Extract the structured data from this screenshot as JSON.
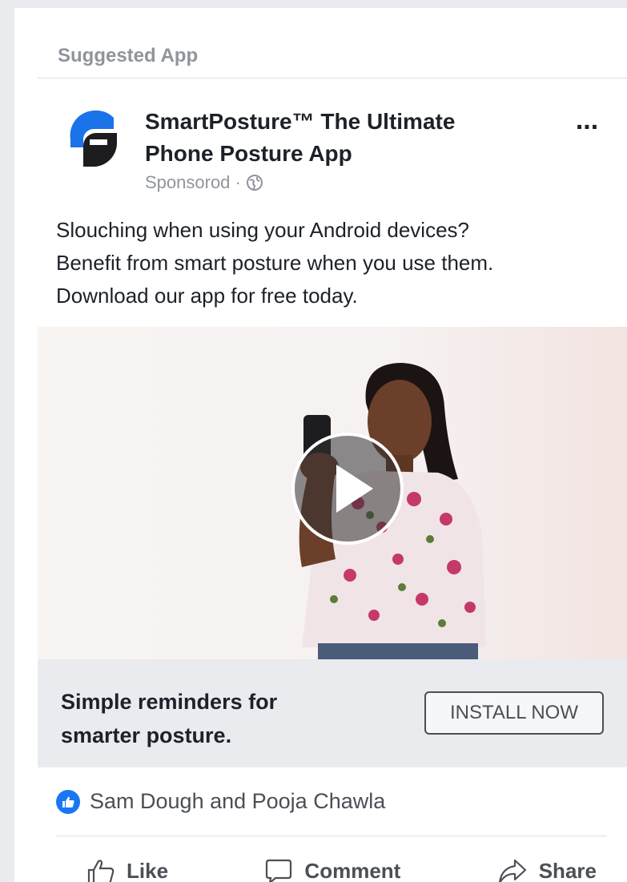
{
  "feed": {
    "header_label": "Suggested App"
  },
  "ad": {
    "title": "SmartPosture™ The Ultimate Phone Posture App",
    "more_label": "...",
    "sponsored_label": "Sponsorod ·",
    "body_lines": [
      "Slouching when using your Android devices?",
      "Benefit from smart posture when you use them.",
      "Download our app for free today."
    ],
    "cta": {
      "headline_lines": [
        "Simple reminders for",
        "smarter posture."
      ],
      "button_label": "INSTALL NOW"
    }
  },
  "social": {
    "likes_text": "Sam Dough and Pooja Chawla"
  },
  "actions": {
    "like_label": "Like",
    "comment_label": "Comment",
    "share_label": "Share"
  },
  "colors": {
    "brand_blue": "#1877f2",
    "text_dark": "#1d2129",
    "text_muted": "#90949c"
  },
  "icons": [
    "logo-icon",
    "globe-icon",
    "play-icon",
    "like-reaction-icon",
    "thumbs-up-icon",
    "comment-icon",
    "share-icon"
  ]
}
